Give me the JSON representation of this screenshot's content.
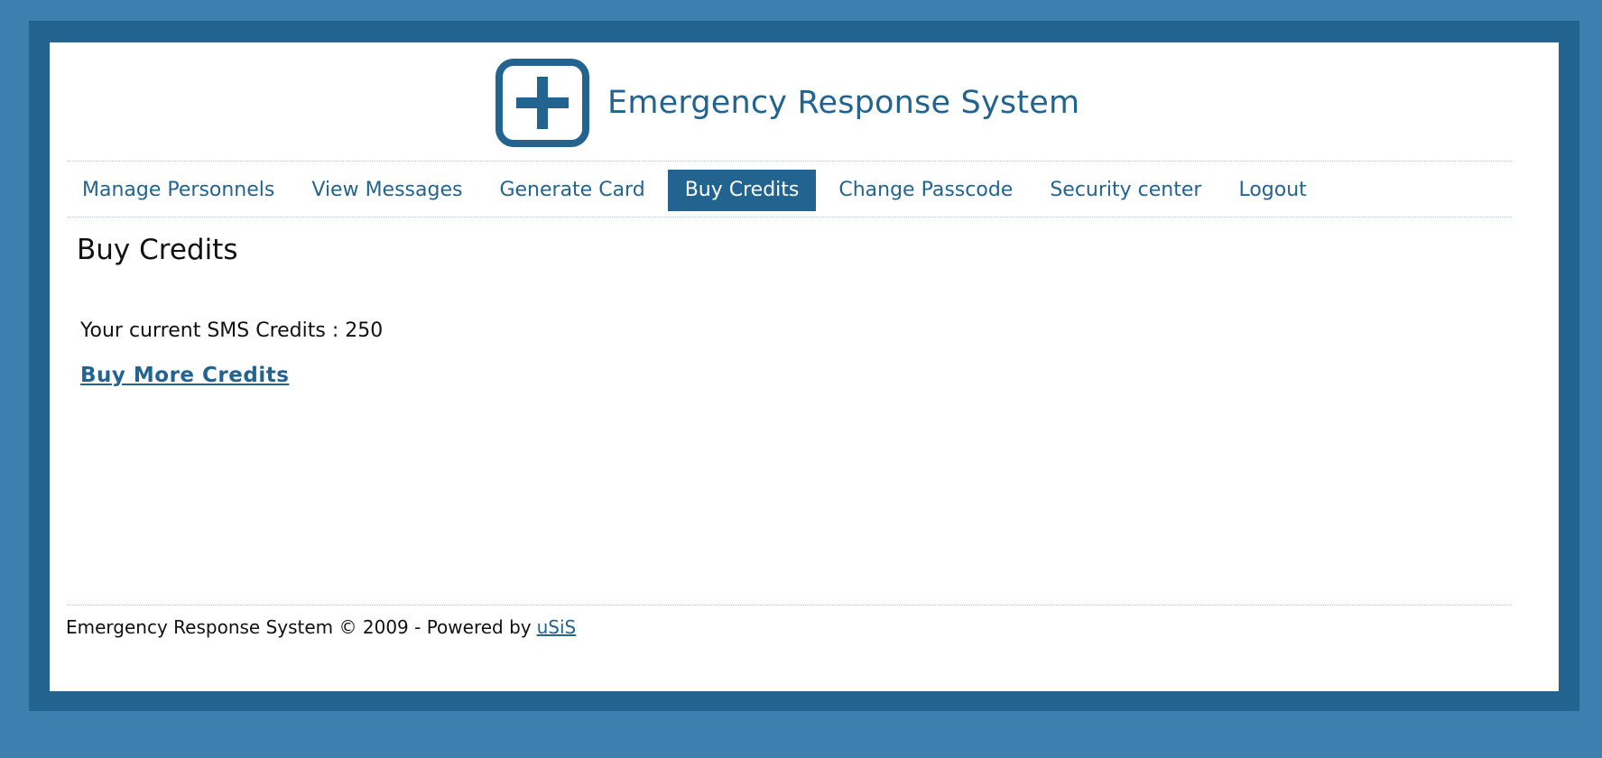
{
  "header": {
    "app_title": "Emergency Response System",
    "logo_icon": "plus-icon"
  },
  "nav": {
    "items": [
      {
        "label": "Manage Personnels",
        "active": false
      },
      {
        "label": "View Messages",
        "active": false
      },
      {
        "label": "Generate Card",
        "active": false
      },
      {
        "label": "Buy Credits",
        "active": true
      },
      {
        "label": "Change Passcode",
        "active": false
      },
      {
        "label": "Security center",
        "active": false
      },
      {
        "label": "Logout",
        "active": false
      }
    ]
  },
  "main": {
    "heading": "Buy Credits",
    "credits_text": "Your current SMS Credits : 250",
    "buy_more_label": "Buy More Credits"
  },
  "footer": {
    "text": "Emergency Response System © 2009 - Powered by",
    "link_label": "uSiS"
  },
  "colors": {
    "page_background": "#3d7fae",
    "frame": "#22648f",
    "accent": "#22648f",
    "panel": "#ffffff"
  }
}
